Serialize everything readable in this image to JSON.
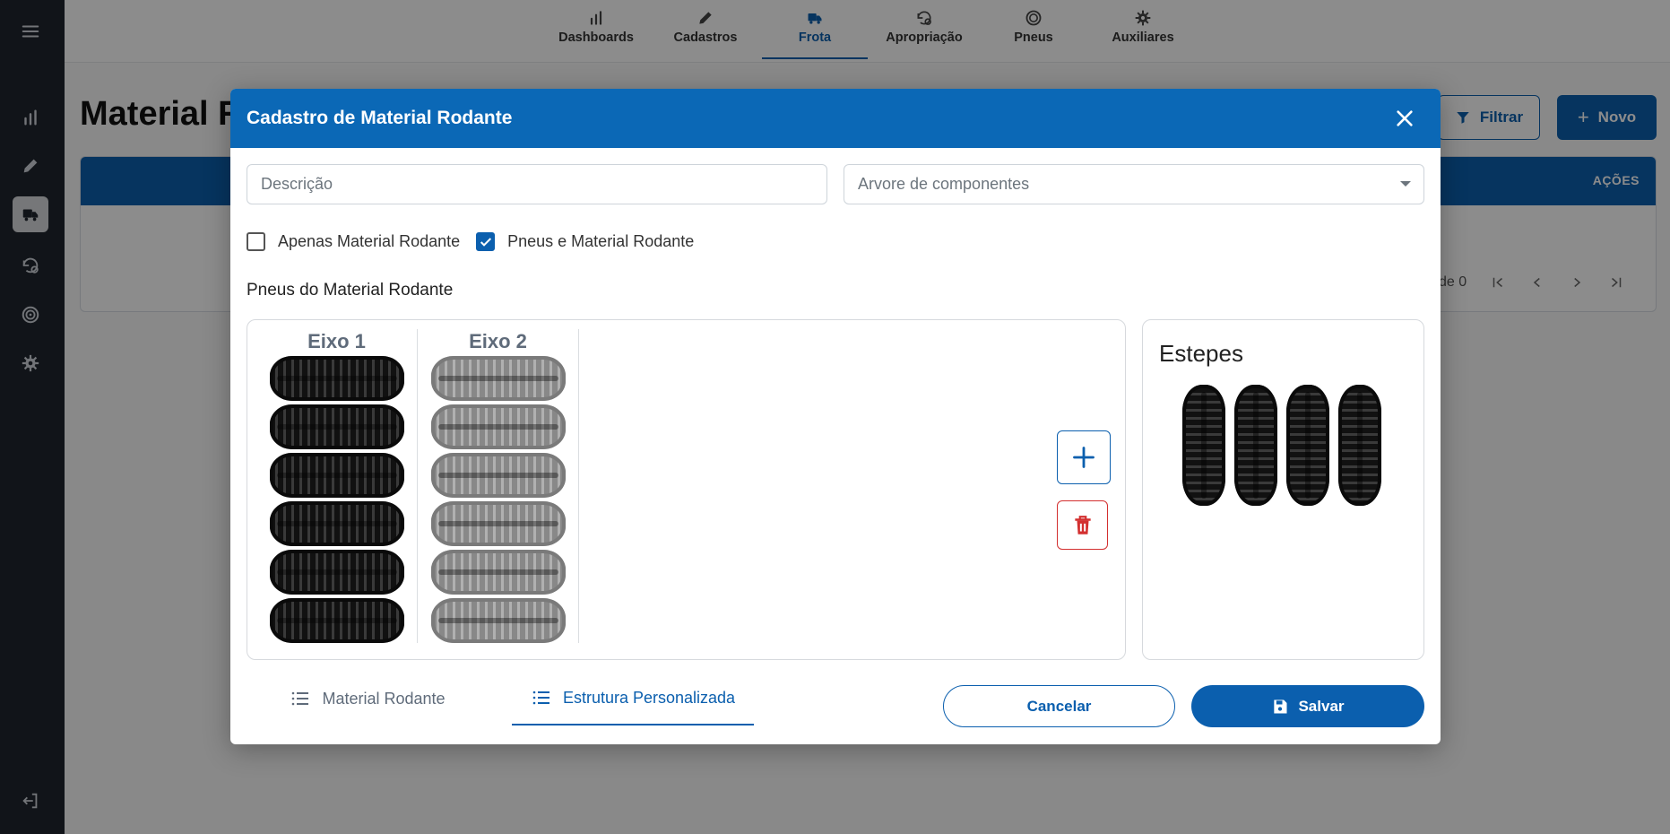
{
  "topnav": {
    "tabs": [
      {
        "label": "Dashboards",
        "icon": "bar-chart-icon"
      },
      {
        "label": "Cadastros",
        "icon": "pencil-icon"
      },
      {
        "label": "Frota",
        "icon": "truck-icon",
        "active": true
      },
      {
        "label": "Apropriação",
        "icon": "history-gear-icon"
      },
      {
        "label": "Pneus",
        "icon": "tire-icon"
      },
      {
        "label": "Auxiliares",
        "icon": "gear-icon"
      }
    ]
  },
  "sidebar": {
    "items": [
      "menu-icon",
      "bar-chart-icon",
      "pencil-icon",
      "truck-icon",
      "history-gear-icon",
      "tire-icon",
      "gear-icon",
      "logout-icon"
    ],
    "active": "truck-icon"
  },
  "background_page": {
    "title": "Material R",
    "filter_label": "Filtrar",
    "new_label": "Novo",
    "table_actions_header": "AÇÕES",
    "pager_text": "de 0"
  },
  "modal": {
    "title": "Cadastro de Material Rodante",
    "description_placeholder": "Descrição",
    "tree_placeholder": "Arvore de componentes",
    "checkbox_only": {
      "label": "Apenas Material Rodante",
      "checked": false
    },
    "checkbox_tires": {
      "label": "Pneus e Material Rodante",
      "checked": true
    },
    "section_label": "Pneus do Material Rodante",
    "axles": [
      {
        "label": "Eixo 1",
        "tire_count": 6,
        "style": "dark"
      },
      {
        "label": "Eixo 2",
        "tire_count": 6,
        "style": "light"
      }
    ],
    "spare_title": "Estepes",
    "spare_count": 4,
    "tabs": [
      {
        "label": "Material Rodante",
        "active": false
      },
      {
        "label": "Estrutura Personalizada",
        "active": true
      }
    ],
    "cancel_label": "Cancelar",
    "save_label": "Salvar"
  },
  "colors": {
    "primary": "#0b5fae",
    "header": "#0b68b6",
    "sidebar": "#1f262e",
    "danger": "#d32f2f"
  }
}
